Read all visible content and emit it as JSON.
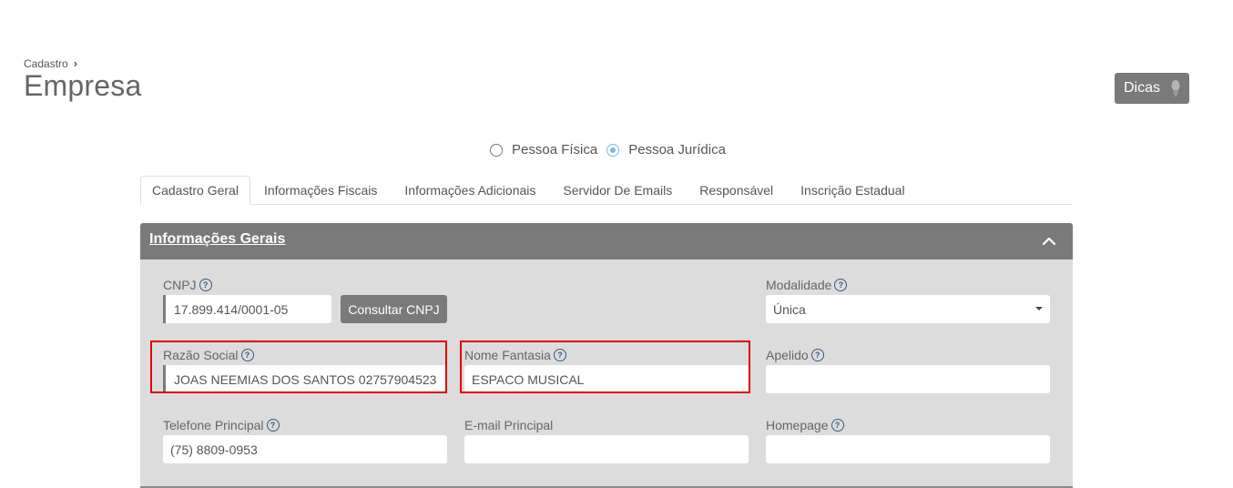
{
  "breadcrumb": {
    "parent": "Cadastro",
    "separator": "›"
  },
  "page": {
    "title": "Empresa"
  },
  "dicas": {
    "label": "Dicas"
  },
  "person_type": {
    "options": [
      {
        "label": "Pessoa Física",
        "checked": false
      },
      {
        "label": "Pessoa Jurídica",
        "checked": true
      }
    ]
  },
  "tabs": [
    {
      "label": "Cadastro Geral",
      "active": true
    },
    {
      "label": "Informações Fiscais",
      "active": false
    },
    {
      "label": "Informações Adicionais",
      "active": false
    },
    {
      "label": "Servidor De Emails",
      "active": false
    },
    {
      "label": "Responsável",
      "active": false
    },
    {
      "label": "Inscrição Estadual",
      "active": false
    }
  ],
  "panel": {
    "title": "Informações Gerais",
    "fields": {
      "cnpj": {
        "label": "CNPJ",
        "value": "17.899.414/0001-05",
        "button": "Consultar CNPJ"
      },
      "modalidade": {
        "label": "Modalidade",
        "value": "Única"
      },
      "razao_social": {
        "label": "Razão Social",
        "value": "JOAS NEEMIAS DOS SANTOS 02757904523"
      },
      "nome_fantasia": {
        "label": "Nome Fantasia",
        "value": "ESPACO MUSICAL"
      },
      "apelido": {
        "label": "Apelido",
        "value": ""
      },
      "telefone": {
        "label": "Telefone Principal",
        "value": "(75) 8809-0953"
      },
      "email": {
        "label": "E-mail Principal",
        "value": ""
      },
      "homepage": {
        "label": "Homepage",
        "value": ""
      }
    }
  },
  "colors": {
    "panel_header": "#7a7a7a",
    "panel_body": "#dcdcdc",
    "highlight": "#e00000",
    "radio_selected": "#7fb8e8",
    "help_icon": "#3a5a82"
  },
  "icons": {
    "help": "question-circle-icon",
    "collapse": "chevron-up-icon",
    "dicas": "lightbulb-icon",
    "breadcrumb_sep": "chevron-right-icon"
  }
}
